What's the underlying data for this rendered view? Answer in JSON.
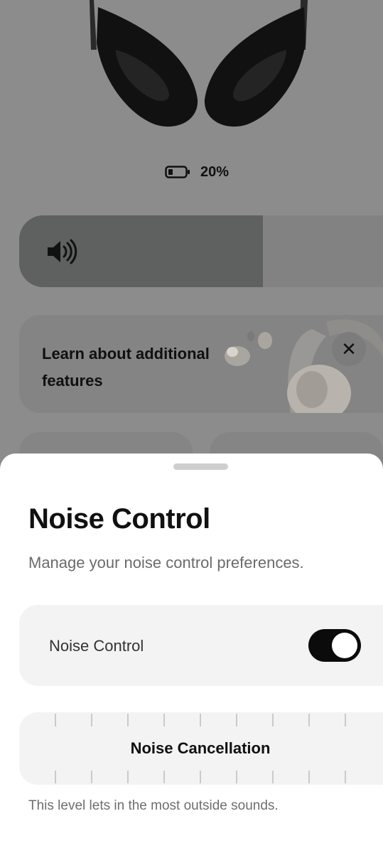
{
  "device": {
    "image_icon": "headphones-image",
    "battery": {
      "icon": "battery-icon",
      "level_text": "20%",
      "level": 0.2
    }
  },
  "volume": {
    "icon": "speaker-icon",
    "level": 0.67
  },
  "promo": {
    "text": "Learn about additional features",
    "image_icon": "earbuds-headphones-image",
    "close_icon": "close-icon"
  },
  "sheet": {
    "title": "Noise Control",
    "subtitle": "Manage your noise control preferences.",
    "toggle": {
      "label": "Noise Control",
      "on": true
    },
    "mode": {
      "label": "Noise Cancellation",
      "description": "This level lets in the most outside sounds."
    }
  },
  "colors": {
    "overlay_bg": "#8c8c8c",
    "sheet_bg": "#ffffff",
    "card_bg": "#f3f3f3",
    "switch_on": "#0b0b0b"
  }
}
